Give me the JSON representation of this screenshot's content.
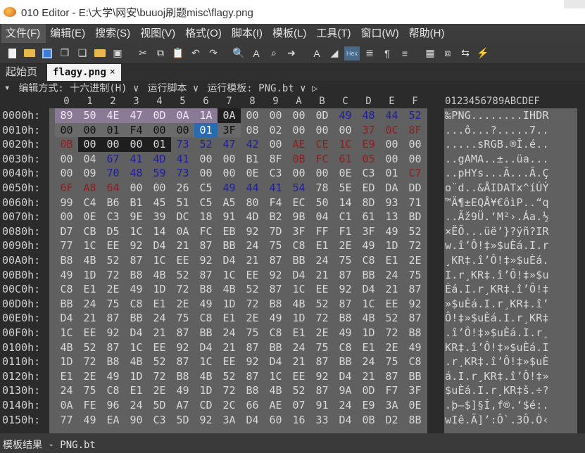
{
  "window": {
    "title": "010 Editor - E:\\大学\\网安\\buuoj刷题misc\\flagy.png"
  },
  "menu": [
    "文件(F)",
    "编辑(E)",
    "搜索(S)",
    "视图(V)",
    "格式(O)",
    "脚本(I)",
    "模板(L)",
    "工具(T)",
    "窗口(W)",
    "帮助(H)"
  ],
  "toolbar": {
    "hex_label": "Hex"
  },
  "tabs": {
    "start": "起始页",
    "file": "flagy.png",
    "close": "×"
  },
  "options": {
    "edit_mode": "编辑方式: 十六进制(H) ∨",
    "run_script": "运行脚本 ∨",
    "run_template": "运行模板: PNG.bt ∨ ▷"
  },
  "columns": [
    "0",
    "1",
    "2",
    "3",
    "4",
    "5",
    "6",
    "7",
    "8",
    "9",
    "A",
    "B",
    "C",
    "D",
    "E",
    "F"
  ],
  "ascii_header": "0123456789ABCDEF",
  "rows": [
    {
      "addr": "0000h:",
      "bytes": [
        "89",
        "50",
        "4E",
        "47",
        "0D",
        "0A",
        "1A",
        "0A",
        "00",
        "00",
        "00",
        "0D",
        "49",
        "48",
        "44",
        "52"
      ],
      "ascii": "‰PNG........IHDR"
    },
    {
      "addr": "0010h:",
      "bytes": [
        "00",
        "00",
        "01",
        "F4",
        "00",
        "00",
        "01",
        "3F",
        "08",
        "02",
        "00",
        "00",
        "00",
        "37",
        "0C",
        "8F"
      ],
      "ascii": "...ô...?.....7.."
    },
    {
      "addr": "0020h:",
      "bytes": [
        "0B",
        "00",
        "00",
        "00",
        "01",
        "73",
        "52",
        "47",
        "42",
        "00",
        "AE",
        "CE",
        "1C",
        "E9",
        "00",
        "00"
      ],
      "ascii": ".....sRGB.®Î.é.."
    },
    {
      "addr": "0030h:",
      "bytes": [
        "00",
        "04",
        "67",
        "41",
        "4D",
        "41",
        "00",
        "00",
        "B1",
        "8F",
        "0B",
        "FC",
        "61",
        "05",
        "00",
        "00"
      ],
      "ascii": "..gAMA..±..üa..."
    },
    {
      "addr": "0040h:",
      "bytes": [
        "00",
        "09",
        "70",
        "48",
        "59",
        "73",
        "00",
        "00",
        "0E",
        "C3",
        "00",
        "00",
        "0E",
        "C3",
        "01",
        "C7"
      ],
      "ascii": "..pHYs...Ã...Ã.Ç"
    },
    {
      "addr": "0050h:",
      "bytes": [
        "6F",
        "A8",
        "64",
        "00",
        "00",
        "26",
        "C5",
        "49",
        "44",
        "41",
        "54",
        "78",
        "5E",
        "ED",
        "DA",
        "DD"
      ],
      "ascii": "o¨d..&ÅIDATx^íÚÝ"
    },
    {
      "addr": "0060h:",
      "bytes": [
        "99",
        "C4",
        "B6",
        "B1",
        "45",
        "51",
        "C5",
        "A5",
        "80",
        "F4",
        "EC",
        "50",
        "14",
        "8D",
        "93",
        "71"
      ],
      "ascii": "™Ä¶±EQÅ¥€ôìP..“q"
    },
    {
      "addr": "0070h:",
      "bytes": [
        "00",
        "0E",
        "C3",
        "9E",
        "39",
        "DC",
        "18",
        "91",
        "4D",
        "B2",
        "9B",
        "04",
        "C1",
        "61",
        "13",
        "BD"
      ],
      "ascii": "..Ãž9Ü.‘M²›.Áa.½"
    },
    {
      "addr": "0080h:",
      "bytes": [
        "D7",
        "CB",
        "D5",
        "1C",
        "14",
        "0A",
        "FC",
        "EB",
        "92",
        "7D",
        "3F",
        "FF",
        "F1",
        "3F",
        "49",
        "52"
      ],
      "ascii": "×ËÕ...üë’}?ÿñ?IR"
    },
    {
      "addr": "0090h:",
      "bytes": [
        "77",
        "1C",
        "EE",
        "92",
        "D4",
        "21",
        "87",
        "BB",
        "24",
        "75",
        "C8",
        "E1",
        "2E",
        "49",
        "1D",
        "72"
      ],
      "ascii": "w.î’Ô!‡»$uÈá.I.r"
    },
    {
      "addr": "00A0h:",
      "bytes": [
        "B8",
        "4B",
        "52",
        "87",
        "1C",
        "EE",
        "92",
        "D4",
        "21",
        "87",
        "BB",
        "24",
        "75",
        "C8",
        "E1",
        "2E"
      ],
      "ascii": "¸KR‡.î’Ô!‡»$uÈá."
    },
    {
      "addr": "00B0h:",
      "bytes": [
        "49",
        "1D",
        "72",
        "B8",
        "4B",
        "52",
        "87",
        "1C",
        "EE",
        "92",
        "D4",
        "21",
        "87",
        "BB",
        "24",
        "75"
      ],
      "ascii": "I.r¸KR‡.î’Ô!‡»$u"
    },
    {
      "addr": "00C0h:",
      "bytes": [
        "C8",
        "E1",
        "2E",
        "49",
        "1D",
        "72",
        "B8",
        "4B",
        "52",
        "87",
        "1C",
        "EE",
        "92",
        "D4",
        "21",
        "87"
      ],
      "ascii": "Èá.I.r¸KR‡.î’Ô!‡"
    },
    {
      "addr": "00D0h:",
      "bytes": [
        "BB",
        "24",
        "75",
        "C8",
        "E1",
        "2E",
        "49",
        "1D",
        "72",
        "B8",
        "4B",
        "52",
        "87",
        "1C",
        "EE",
        "92"
      ],
      "ascii": "»$uÈá.I.r¸KR‡.î’"
    },
    {
      "addr": "00E0h:",
      "bytes": [
        "D4",
        "21",
        "87",
        "BB",
        "24",
        "75",
        "C8",
        "E1",
        "2E",
        "49",
        "1D",
        "72",
        "B8",
        "4B",
        "52",
        "87"
      ],
      "ascii": "Ô!‡»$uÈá.I.r¸KR‡"
    },
    {
      "addr": "00F0h:",
      "bytes": [
        "1C",
        "EE",
        "92",
        "D4",
        "21",
        "87",
        "BB",
        "24",
        "75",
        "C8",
        "E1",
        "2E",
        "49",
        "1D",
        "72",
        "B8"
      ],
      "ascii": ".î’Ô!‡»$uÈá.I.r¸"
    },
    {
      "addr": "0100h:",
      "bytes": [
        "4B",
        "52",
        "87",
        "1C",
        "EE",
        "92",
        "D4",
        "21",
        "87",
        "BB",
        "24",
        "75",
        "C8",
        "E1",
        "2E",
        "49"
      ],
      "ascii": "KR‡.î’Ô!‡»$uÈá.I"
    },
    {
      "addr": "0110h:",
      "bytes": [
        "1D",
        "72",
        "B8",
        "4B",
        "52",
        "87",
        "1C",
        "EE",
        "92",
        "D4",
        "21",
        "87",
        "BB",
        "24",
        "75",
        "C8"
      ],
      "ascii": ".r¸KR‡.î’Ô!‡»$uÈ"
    },
    {
      "addr": "0120h:",
      "bytes": [
        "E1",
        "2E",
        "49",
        "1D",
        "72",
        "B8",
        "4B",
        "52",
        "87",
        "1C",
        "EE",
        "92",
        "D4",
        "21",
        "87",
        "BB"
      ],
      "ascii": "á.I.r¸KR‡.î’Ô!‡»"
    },
    {
      "addr": "0130h:",
      "bytes": [
        "24",
        "75",
        "C8",
        "E1",
        "2E",
        "49",
        "1D",
        "72",
        "B8",
        "4B",
        "52",
        "87",
        "9A",
        "0D",
        "F7",
        "3F"
      ],
      "ascii": "$uÈá.I.r¸KR‡š.÷?"
    },
    {
      "addr": "0140h:",
      "bytes": [
        "0A",
        "FE",
        "96",
        "24",
        "5D",
        "A7",
        "CD",
        "2C",
        "66",
        "AE",
        "07",
        "91",
        "24",
        "E9",
        "3A",
        "0E"
      ],
      "ascii": ".þ–$]§Í,f®.‘$é:."
    },
    {
      "addr": "0150h:",
      "bytes": [
        "77",
        "49",
        "EA",
        "90",
        "C3",
        "5D",
        "92",
        "3A",
        "D4",
        "60",
        "16",
        "33",
        "D4",
        "0B",
        "D2",
        "8B"
      ],
      "ascii": "wIê.Ã]’:Ô`.3Ô.Ò‹"
    }
  ],
  "status": "模板结果 - PNG.bt"
}
